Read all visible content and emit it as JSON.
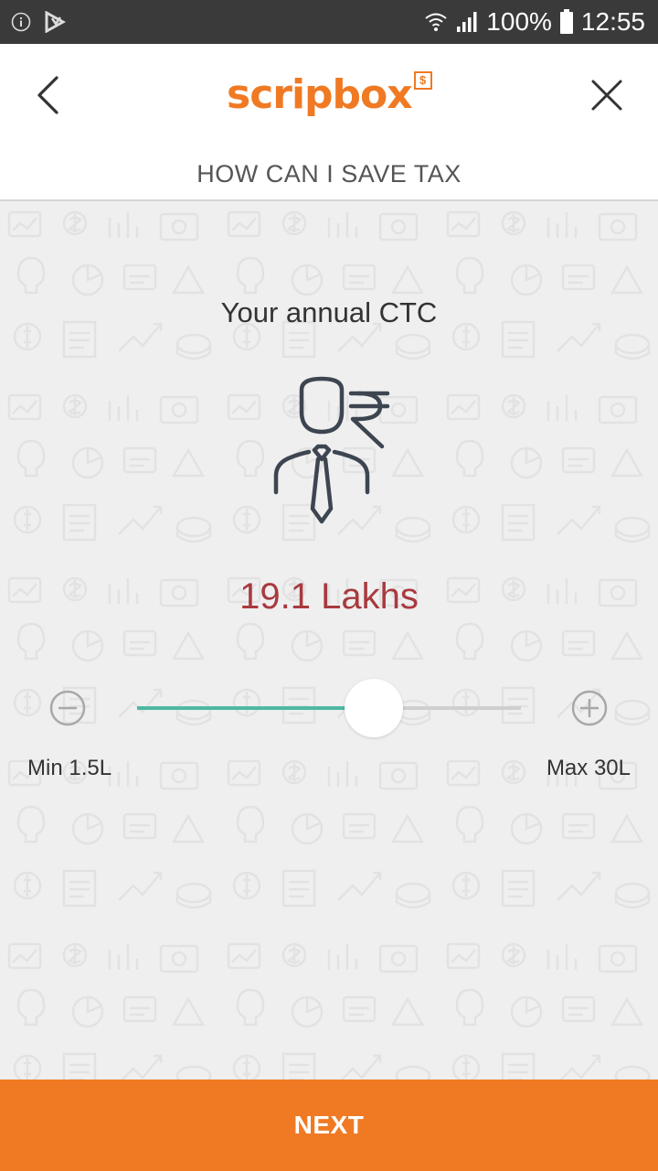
{
  "status_bar": {
    "left_icons": [
      "info-icon",
      "play-icon"
    ],
    "right_icons": [
      "wifi-icon",
      "signal-icon",
      "battery-icon"
    ],
    "battery": "100%",
    "time": "12:55"
  },
  "app_bar": {
    "back_icon": "chevron-left-icon",
    "logo_text": "scripbox",
    "logo_badge": "$",
    "close_icon": "close-icon"
  },
  "subheader": {
    "title": "HOW CAN I SAVE TAX"
  },
  "main": {
    "question": "Your annual CTC",
    "illustration_icon": "person-rupee-icon",
    "value_text": "19.1 Lakhs",
    "slider": {
      "min": 1.5,
      "max": 30,
      "value": 19.1,
      "min_label": "Min 1.5L",
      "max_label": "Max 30L",
      "minus_icon": "minus-circle-icon",
      "plus_icon": "plus-circle-icon"
    }
  },
  "footer": {
    "next_label": "NEXT"
  },
  "colors": {
    "brand": "#f07a23",
    "value": "#a83a3f",
    "slider_fill": "#4fb8a4",
    "background": "#efefef"
  }
}
